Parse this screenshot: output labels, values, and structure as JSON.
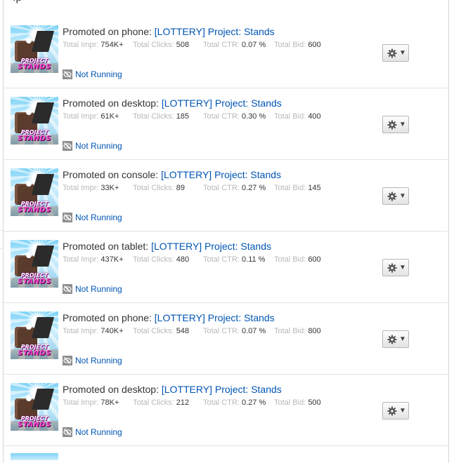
{
  "page": {
    "header_fragment": "ıp"
  },
  "labels": {
    "impr": "Total Impr: ",
    "clicks": "Total Clicks: ",
    "ctr": "Total CTR: ",
    "bid": "Total Bid: "
  },
  "ads": [
    {
      "promoted_on": "Promoted on phone: ",
      "name": "[LOTTERY] Project: Stands",
      "impr": "754K+",
      "clicks": "508",
      "ctr": "0.07 %",
      "bid": "600",
      "status": "Not Running",
      "thumb_logo_line1": "PROJECT",
      "thumb_logo_line2": "STANDS"
    },
    {
      "promoted_on": "Promoted on desktop: ",
      "name": "[LOTTERY] Project: Stands",
      "impr": "61K+",
      "clicks": "185",
      "ctr": "0.30 %",
      "bid": "400",
      "status": "Not Running",
      "thumb_logo_line1": "PROJECT",
      "thumb_logo_line2": "STANDS"
    },
    {
      "promoted_on": "Promoted on console: ",
      "name": "[LOTTERY] Project: Stands",
      "impr": "33K+",
      "clicks": "89",
      "ctr": "0.27 %",
      "bid": "145",
      "status": "Not Running",
      "thumb_logo_line1": "PROJECT",
      "thumb_logo_line2": "STANDS"
    },
    {
      "promoted_on": "Promoted on tablet: ",
      "name": "[LOTTERY] Project: Stands",
      "impr": "437K+",
      "clicks": "480",
      "ctr": "0.11 %",
      "bid": "600",
      "status": "Not Running",
      "thumb_logo_line1": "PROJECT",
      "thumb_logo_line2": "STANDS"
    },
    {
      "promoted_on": "Promoted on phone: ",
      "name": "[LOTTERY] Project: Stands",
      "impr": "740K+",
      "clicks": "548",
      "ctr": "0.07 %",
      "bid": "800",
      "status": "Not Running",
      "thumb_logo_line1": "PROJECT",
      "thumb_logo_line2": "STANDS"
    },
    {
      "promoted_on": "Promoted on desktop: ",
      "name": "[LOTTERY] Project: Stands",
      "impr": "78K+",
      "clicks": "212",
      "ctr": "0.27 %",
      "bid": "500",
      "status": "Not Running",
      "thumb_logo_line1": "PROJECT",
      "thumb_logo_line2": "STANDS"
    }
  ],
  "icons": {
    "status": "eye-slash-icon",
    "settings": "gear-icon",
    "dropdown": "caret-down-icon"
  },
  "colors": {
    "link": "#0055b3",
    "label_muted": "#b8b8b8",
    "text": "#343434",
    "status_icon_bg": "#8e8e8e",
    "divider": "#e3e3e3"
  }
}
